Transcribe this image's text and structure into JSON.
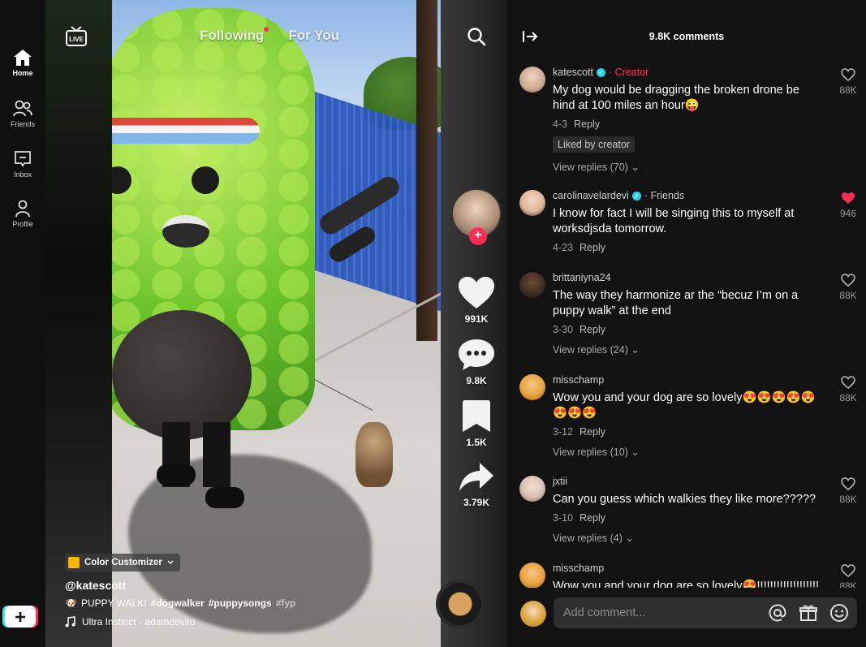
{
  "nav": {
    "items": [
      {
        "label": "Home",
        "icon": "home-icon"
      },
      {
        "label": "Friends",
        "icon": "friends-icon"
      },
      {
        "label": "Inbox",
        "icon": "inbox-icon"
      },
      {
        "label": "Profile",
        "icon": "profile-icon"
      }
    ],
    "create_icon": "plus-icon"
  },
  "top": {
    "live_label": "LIVE",
    "tabs": [
      {
        "label": "Following",
        "has_dot": true
      },
      {
        "label": "For You"
      }
    ]
  },
  "actions": {
    "likes": "991K",
    "comments": "9.8K",
    "saves": "1.5K",
    "shares": "3.79K",
    "follow_symbol": "+"
  },
  "caption": {
    "effect": "Color Customizer",
    "author": "@katescott",
    "description_emoji": "🐶",
    "description_text": "PUPPY WALK!",
    "tags": [
      "#dogwalker",
      "#puppysongs",
      "#fyp"
    ],
    "sound": "Ultra Instinct - adamdevito"
  },
  "comments": {
    "title": "9.8K comments",
    "items": [
      {
        "user": "katescott",
        "verified": true,
        "badge": "· Creator",
        "text": "My dog would be dragging the broken drone be hind at 100 miles an hour😜",
        "date": "4-3",
        "reply": "Reply",
        "liked_by_creator": "Liked by creator",
        "view_replies": "View replies (70)",
        "likes": "88K",
        "liked": false,
        "avatar_color": "#c9a88f"
      },
      {
        "user": "carolinavelardevi",
        "verified": true,
        "badge": "· Friends",
        "text": "I know for fact I will be singing this to myself at worksdjsda  tomorrow.",
        "date": "4-23",
        "reply": "Reply",
        "likes": "946",
        "liked": true,
        "avatar_color": "#e0b79a"
      },
      {
        "user": "brittaniyna24",
        "verified": false,
        "badge": "",
        "text": "The way they harmonize ar the “becuz I’m on a puppy walk” at the end",
        "date": "3-30",
        "reply": "Reply",
        "view_replies": "View replies (24)",
        "likes": "88K",
        "liked": false,
        "avatar_color": "#3c2a22"
      },
      {
        "user": "misschamp",
        "verified": false,
        "badge": "",
        "text": "Wow you and your dog are so lovely😍😍😍😍😍😍😍😍",
        "date": "3-12",
        "reply": "Reply",
        "view_replies": "View replies (10)",
        "likes": "88K",
        "liked": false,
        "avatar_color": "#e8a23a"
      },
      {
        "user": "jxtii",
        "verified": false,
        "badge": "",
        "text": "Can you guess which walkies they like more?????",
        "date": "3-10",
        "reply": "Reply",
        "view_replies": "View replies (4)",
        "likes": "88K",
        "liked": false,
        "avatar_color": "#d8c0b0"
      },
      {
        "user": "misschamp",
        "verified": false,
        "badge": "",
        "text": "Wow you and your dog are so lovely😍!!!!!!!!!!!!!!!!!!!",
        "date": "",
        "reply": "",
        "likes": "88K",
        "liked": false,
        "avatar_color": "#e8a23a"
      }
    ],
    "input_placeholder": "Add comment...",
    "input_icons": [
      "mention-icon",
      "gift-icon",
      "emoji-icon"
    ]
  },
  "colors": {
    "accent": "#fe2c55",
    "verified": "#20d5ec",
    "panel": "#121212"
  }
}
